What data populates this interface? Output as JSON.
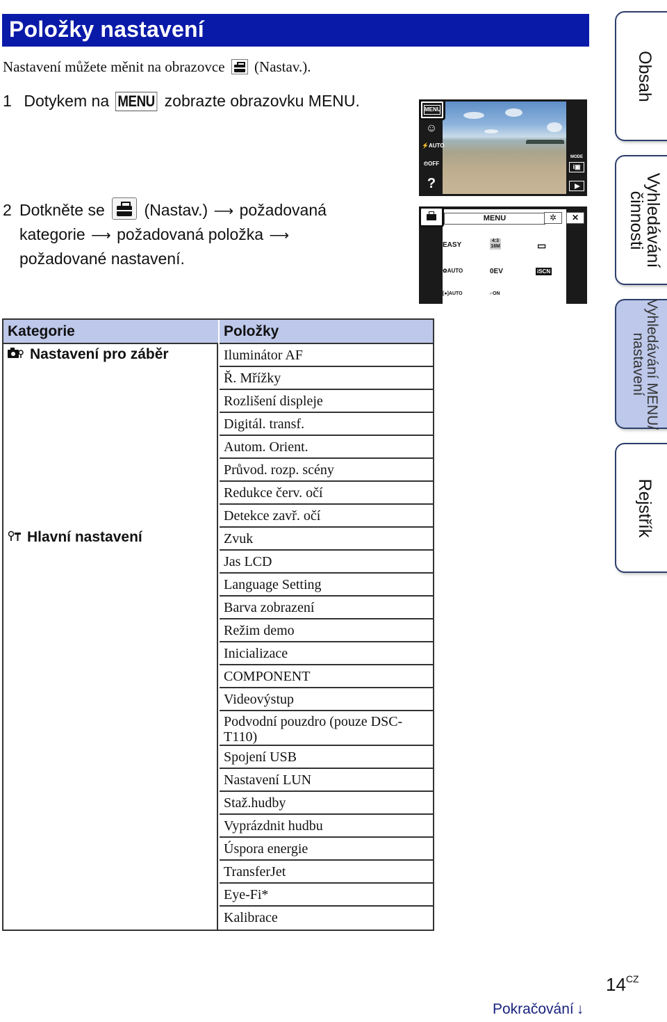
{
  "header": {
    "title": "Položky nastavení"
  },
  "intro": {
    "text_before": "Nastavení můžete měnit na obrazovce",
    "icon": "toolbox-icon",
    "text_after": "(Nastav.)."
  },
  "steps": [
    {
      "num": "1",
      "before": "Dotykem na",
      "key": "MENU",
      "after": "zobrazte obrazovku MENU."
    },
    {
      "num": "2",
      "before": "Dotkněte se",
      "icon": "toolbox-icon",
      "part1": "(Nastav.)",
      "part2": "požadovaná",
      "line2a": "kategorie",
      "line2b": "požadovaná položka",
      "line3": "požadované nastavení.",
      "arrow": "⟶"
    }
  ],
  "camera_screen_1": {
    "menu_button": "MENU",
    "left_buttons": [
      "☺",
      "⚡AUTO",
      "⏲OFF",
      "?"
    ],
    "mode_label": "MODE",
    "mode_button": "i📷",
    "play_button": "play-icon"
  },
  "camera_screen_2": {
    "menu_title": "MENU",
    "gear": "✲",
    "close": "✕",
    "grid": [
      [
        "EASY",
        "4:3 16M",
        "▭"
      ],
      [
        "✿AUTO",
        "0EV",
        "iSCN"
      ],
      [
        "[●]AUTO",
        "⌐ON",
        ""
      ]
    ]
  },
  "table": {
    "headers": [
      "Kategorie",
      "Položky"
    ],
    "categories": [
      {
        "label": "Nastavení pro záběr",
        "icon": "camera-settings-icon"
      },
      {
        "label": "Hlavní nastavení",
        "icon": "tools-icon"
      }
    ],
    "items": [
      "Iluminátor AF",
      "Ř. Mřížky",
      "Rozlišení displeje",
      "Digitál. transf.",
      "Autom. Orient.",
      "Průvod. rozp. scény",
      "Redukce červ. očí",
      "Detekce zavř. očí",
      "Zvuk",
      "Jas LCD",
      "Language Setting",
      "Barva zobrazení",
      "Režim demo",
      "Inicializace",
      "COMPONENT",
      "Videovýstup",
      "Podvodní pouzdro (pouze DSC-T110)",
      "Spojení USB",
      "Nastavení LUN",
      "Stаž.hudby",
      "Vyprázdnit hudbu",
      "Úspora energie",
      "TransferJet",
      "Eye-Fi*",
      "Kalibrace"
    ]
  },
  "side_tabs": [
    {
      "label": "Obsah",
      "active": false
    },
    {
      "label": "Vyhledávání\nčinnosti",
      "active": false
    },
    {
      "label": "Vyhledávání MENU/\nnastavení",
      "active": true
    },
    {
      "label": "Rejstřík",
      "active": false
    }
  ],
  "footer": {
    "page": "14",
    "lang": "CZ",
    "continue": "Pokračování",
    "continue_arrow": "↓"
  },
  "colors": {
    "title_bar": "#0a1aa8",
    "header_fill": "#bdc8ea",
    "continue_text": "#1a237e"
  }
}
